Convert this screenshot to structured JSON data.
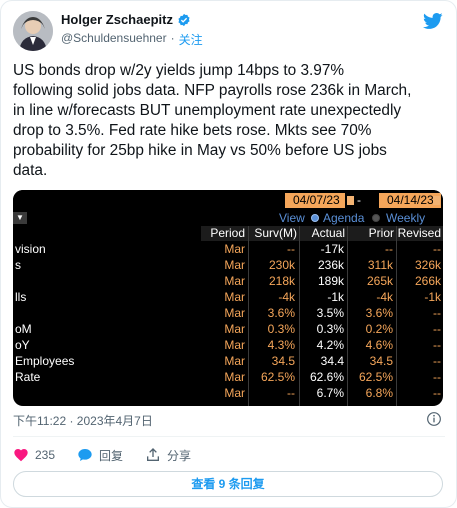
{
  "author": {
    "display_name": "Holger Zschaepitz",
    "handle": "@Schuldensuehner",
    "separator": "·",
    "follow_label": "关注"
  },
  "tweet": {
    "text": "US bonds drop w/2y yields jump 14bps to 3.97%\nfollowing solid jobs data. NFP payrolls rose 236k in March,\nin line w/forecasts BUT unemployment rate unexpectedly\ndrop to 3.5%. Fed rate hike bets rose. Mkts see 70%\nprobability for 25bp hike in May vs 50% before US jobs\ndata.",
    "timestamp": "下午11:22 · 2023年4月7日"
  },
  "media": {
    "date_start": "04/07/23",
    "date_end": "04/14/23",
    "date_sep": "-",
    "dropdown_glyph": "▼",
    "view_label": "View",
    "agenda_label": "Agenda",
    "weekly_label": "Weekly",
    "columns": {
      "period": "Period",
      "surv": "Surv(M)",
      "actual": "Actual",
      "prior": "Prior",
      "revised": "Revised"
    },
    "rows": [
      {
        "label": "vision",
        "period": "Mar",
        "surv": "--",
        "actual": "-17k",
        "prior": "--",
        "revised": "--"
      },
      {
        "label": "s",
        "period": "Mar",
        "surv": "230k",
        "actual": "236k",
        "prior": "311k",
        "revised": "326k"
      },
      {
        "label": "",
        "period": "Mar",
        "surv": "218k",
        "actual": "189k",
        "prior": "265k",
        "revised": "266k"
      },
      {
        "label": "lls",
        "period": "Mar",
        "surv": "-4k",
        "actual": "-1k",
        "prior": "-4k",
        "revised": "-1k"
      },
      {
        "label": "",
        "period": "Mar",
        "surv": "3.6%",
        "actual": "3.5%",
        "prior": "3.6%",
        "revised": "--"
      },
      {
        "label": "oM",
        "period": "Mar",
        "surv": "0.3%",
        "actual": "0.3%",
        "prior": "0.2%",
        "revised": "--"
      },
      {
        "label": "oY",
        "period": "Mar",
        "surv": "4.3%",
        "actual": "4.2%",
        "prior": "4.6%",
        "revised": "--"
      },
      {
        "label": "Employees",
        "period": "Mar",
        "surv": "34.5",
        "actual": "34.4",
        "prior": "34.5",
        "revised": "--"
      },
      {
        "label": "Rate",
        "period": "Mar",
        "surv": "62.5%",
        "actual": "62.6%",
        "prior": "62.5%",
        "revised": "--"
      },
      {
        "label": "",
        "period": "Mar",
        "surv": "--",
        "actual": "6.7%",
        "prior": "6.8%",
        "revised": "--"
      }
    ]
  },
  "actions": {
    "likes": "235",
    "reply_label": "回复",
    "share_label": "分享",
    "view_replies_label": "查看 9 条回复"
  },
  "colors": {
    "accent": "#1d9bf0",
    "like": "#f91880",
    "terminal_orange": "#f5a65a",
    "terminal_bg": "#000000"
  },
  "icons": {
    "verified": "verified-badge-icon",
    "brand": "twitter-bird-icon",
    "info": "info-icon",
    "like": "heart-icon",
    "reply": "reply-bubble-icon",
    "share": "share-icon"
  }
}
